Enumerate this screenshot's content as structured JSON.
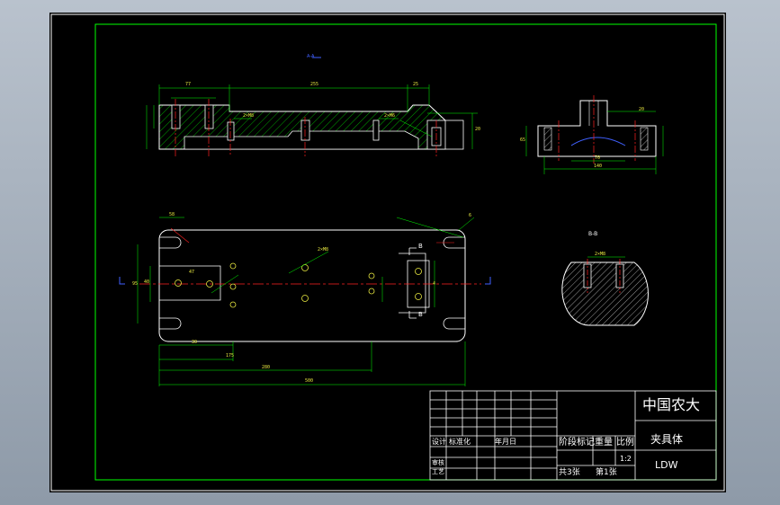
{
  "drawing": {
    "section_label": "B-B",
    "view_marker": "A-A",
    "section_marker": "B"
  },
  "dimensions": {
    "top_view": [
      "77",
      "255",
      "25",
      "2×M8",
      "2×M6",
      "20"
    ],
    "side_view": [
      "20",
      "140",
      "70",
      "65"
    ],
    "plan_view": [
      "58",
      "6",
      "2×M8",
      "4",
      "40",
      "95",
      "47",
      "30",
      "175",
      "280",
      "500"
    ],
    "section_view": [
      "2×M8"
    ]
  },
  "title_block": {
    "company": "中国农大",
    "part_name": "夹具体",
    "drawing_no": "LDW",
    "labels": {
      "design": "设计",
      "standardize": "标准化",
      "process_check": "审核",
      "process": "工艺",
      "stage_mark": "阶段标记",
      "weight": "重量",
      "scale": "比例",
      "scale_value": "1:2",
      "total_sheets": "共3张",
      "sheet_no": "第1张",
      "date_col": "年月日"
    }
  },
  "colors": {
    "frame": "#00ff00",
    "outline": "#ffffff",
    "hatch": "#00dd00",
    "dimension": "#00ff00",
    "centerline": "#ff2020",
    "dim_text": "#e8e840",
    "marker": "#4060ff"
  }
}
